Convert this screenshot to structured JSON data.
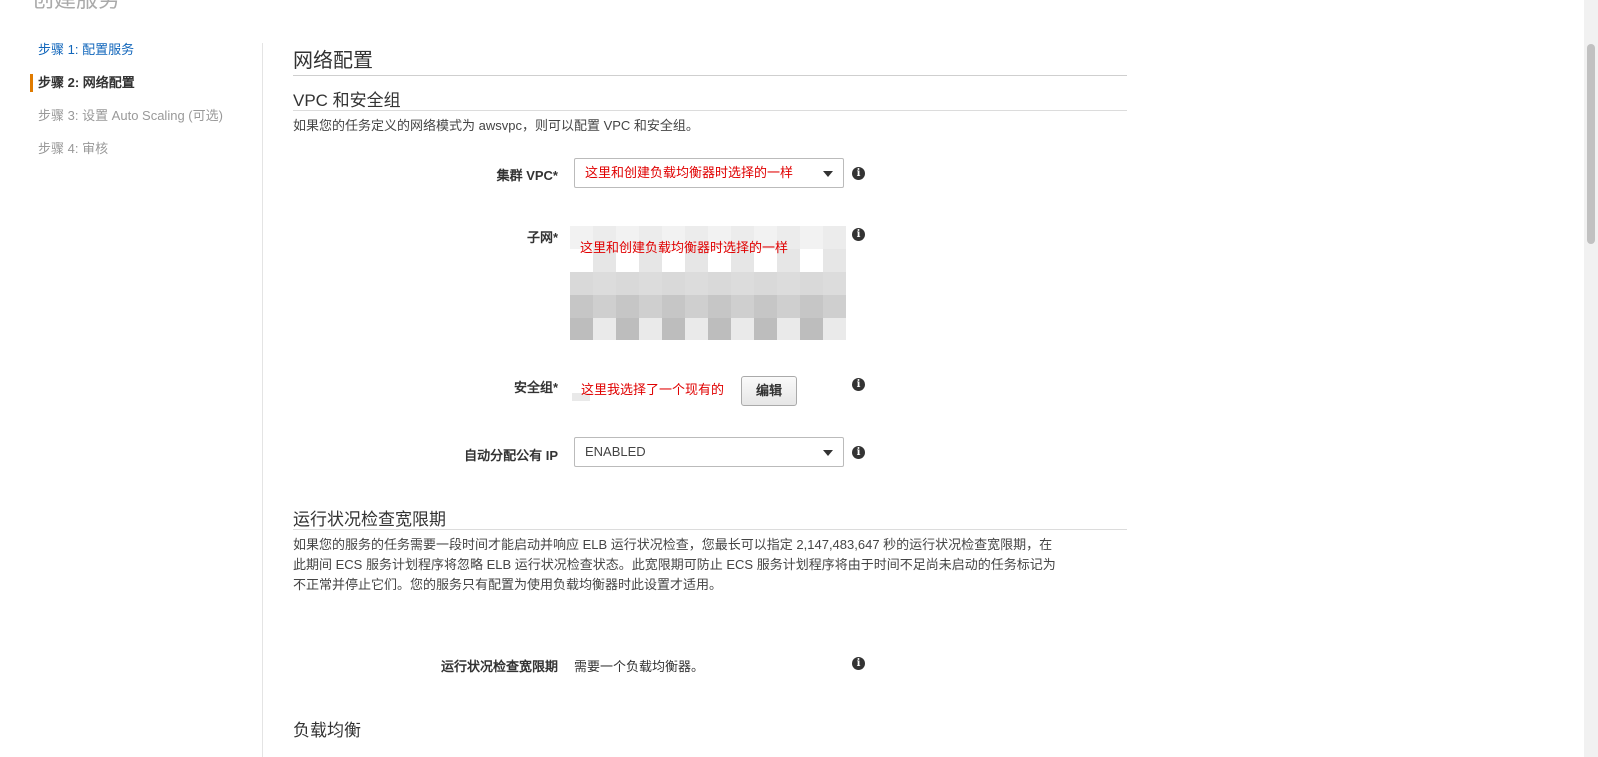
{
  "page": {
    "title": "创建服务"
  },
  "steps": [
    {
      "label": "步骤 1: 配置服务",
      "state": "link"
    },
    {
      "label": "步骤 2: 网络配置",
      "state": "active"
    },
    {
      "label": "步骤 3: 设置 Auto Scaling (可选)",
      "state": "disabled"
    },
    {
      "label": "步骤 4: 审核",
      "state": "disabled"
    }
  ],
  "section": {
    "title": "网络配置"
  },
  "vpc": {
    "title": "VPC 和安全组",
    "description": "如果您的任务定义的网络模式为 awsvpc，则可以配置 VPC 和安全组。",
    "cluster_vpc": {
      "label": "集群 VPC*",
      "value": "这里和创建负载均衡器时选择的一样"
    },
    "subnet": {
      "label": "子网*",
      "value": "这里和创建负载均衡器时选择的一样"
    },
    "security_group": {
      "label": "安全组*",
      "value": "这里我选择了一个现有的",
      "edit_label": "编辑"
    },
    "public_ip": {
      "label": "自动分配公有 IP",
      "value": "ENABLED"
    }
  },
  "grace": {
    "title": "运行状况检查宽限期",
    "description_lines": [
      "如果您的服务的任务需要一段时间才能启动并响应 ELB 运行状况检查，您最长可以指定 2,147,483,647 秒的运行状况检查宽限期，在",
      "此期间 ECS 服务计划程序将忽略 ELB 运行状况检查状态。此宽限期可防止 ECS 服务计划程序将由于时间不足尚未启动的任务标记为",
      "不正常并停止它们。您的服务只有配置为使用负载均衡器时此设置才适用。"
    ],
    "field": {
      "label": "运行状况检查宽限期",
      "value": "需要一个负载均衡器。"
    }
  },
  "load_balancing": {
    "title": "负载均衡"
  },
  "icons": {
    "info": "info-icon",
    "dropdown": "chevron-down-icon"
  },
  "colors": {
    "active_accent": "#e07b00",
    "link": "#1166bb",
    "annotation": "#e00000"
  }
}
